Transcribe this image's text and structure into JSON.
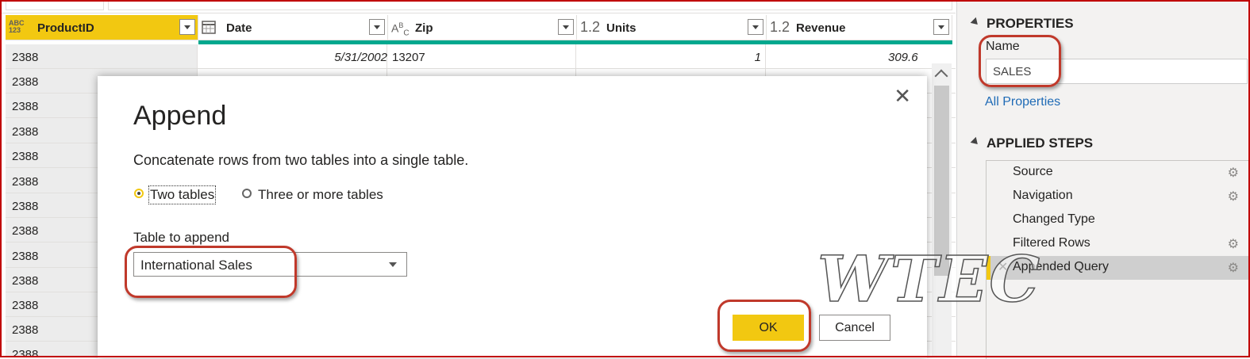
{
  "grid": {
    "columns": [
      {
        "type_icon": "ABC/123",
        "name": "ProductID",
        "active": true
      },
      {
        "type_icon": "calendar",
        "name": "Date"
      },
      {
        "type_icon": "ABC",
        "name": "Zip"
      },
      {
        "type_icon": "1.2",
        "name": "Units"
      },
      {
        "type_icon": "1.2",
        "name": "Revenue"
      }
    ],
    "first_row": {
      "product_id": "2388",
      "date": "5/31/2002",
      "zip": "13207",
      "units": "1",
      "revenue": "309.6"
    },
    "product_ids": [
      "2388",
      "2388",
      "2388",
      "2388",
      "2388",
      "2388",
      "2388",
      "2388",
      "2388",
      "2388",
      "2388",
      "2388",
      "2388",
      "2388"
    ]
  },
  "properties": {
    "heading": "PROPERTIES",
    "name_label": "Name",
    "name_value": "SALES",
    "all_properties_link": "All Properties"
  },
  "applied_steps": {
    "heading": "APPLIED STEPS",
    "steps": [
      {
        "label": "Source",
        "gear": true
      },
      {
        "label": "Navigation",
        "gear": true
      },
      {
        "label": "Changed Type",
        "gear": false
      },
      {
        "label": "Filtered Rows",
        "gear": true
      },
      {
        "label": "Appended Query",
        "gear": true,
        "selected": true
      }
    ]
  },
  "dialog": {
    "title": "Append",
    "description": "Concatenate rows from two tables into a single table.",
    "option_two": "Two tables",
    "option_three": "Three or more tables",
    "selected_option": "Two tables",
    "table_label": "Table to append",
    "table_value": "International Sales",
    "ok_label": "OK",
    "cancel_label": "Cancel",
    "close_icon": "close-icon"
  },
  "watermark": "WTEC",
  "colors": {
    "accent": "#f2c811",
    "teal": "#00a88e",
    "annotation": "#c0392b",
    "link": "#1f6bb6",
    "frame": "#c00000"
  }
}
